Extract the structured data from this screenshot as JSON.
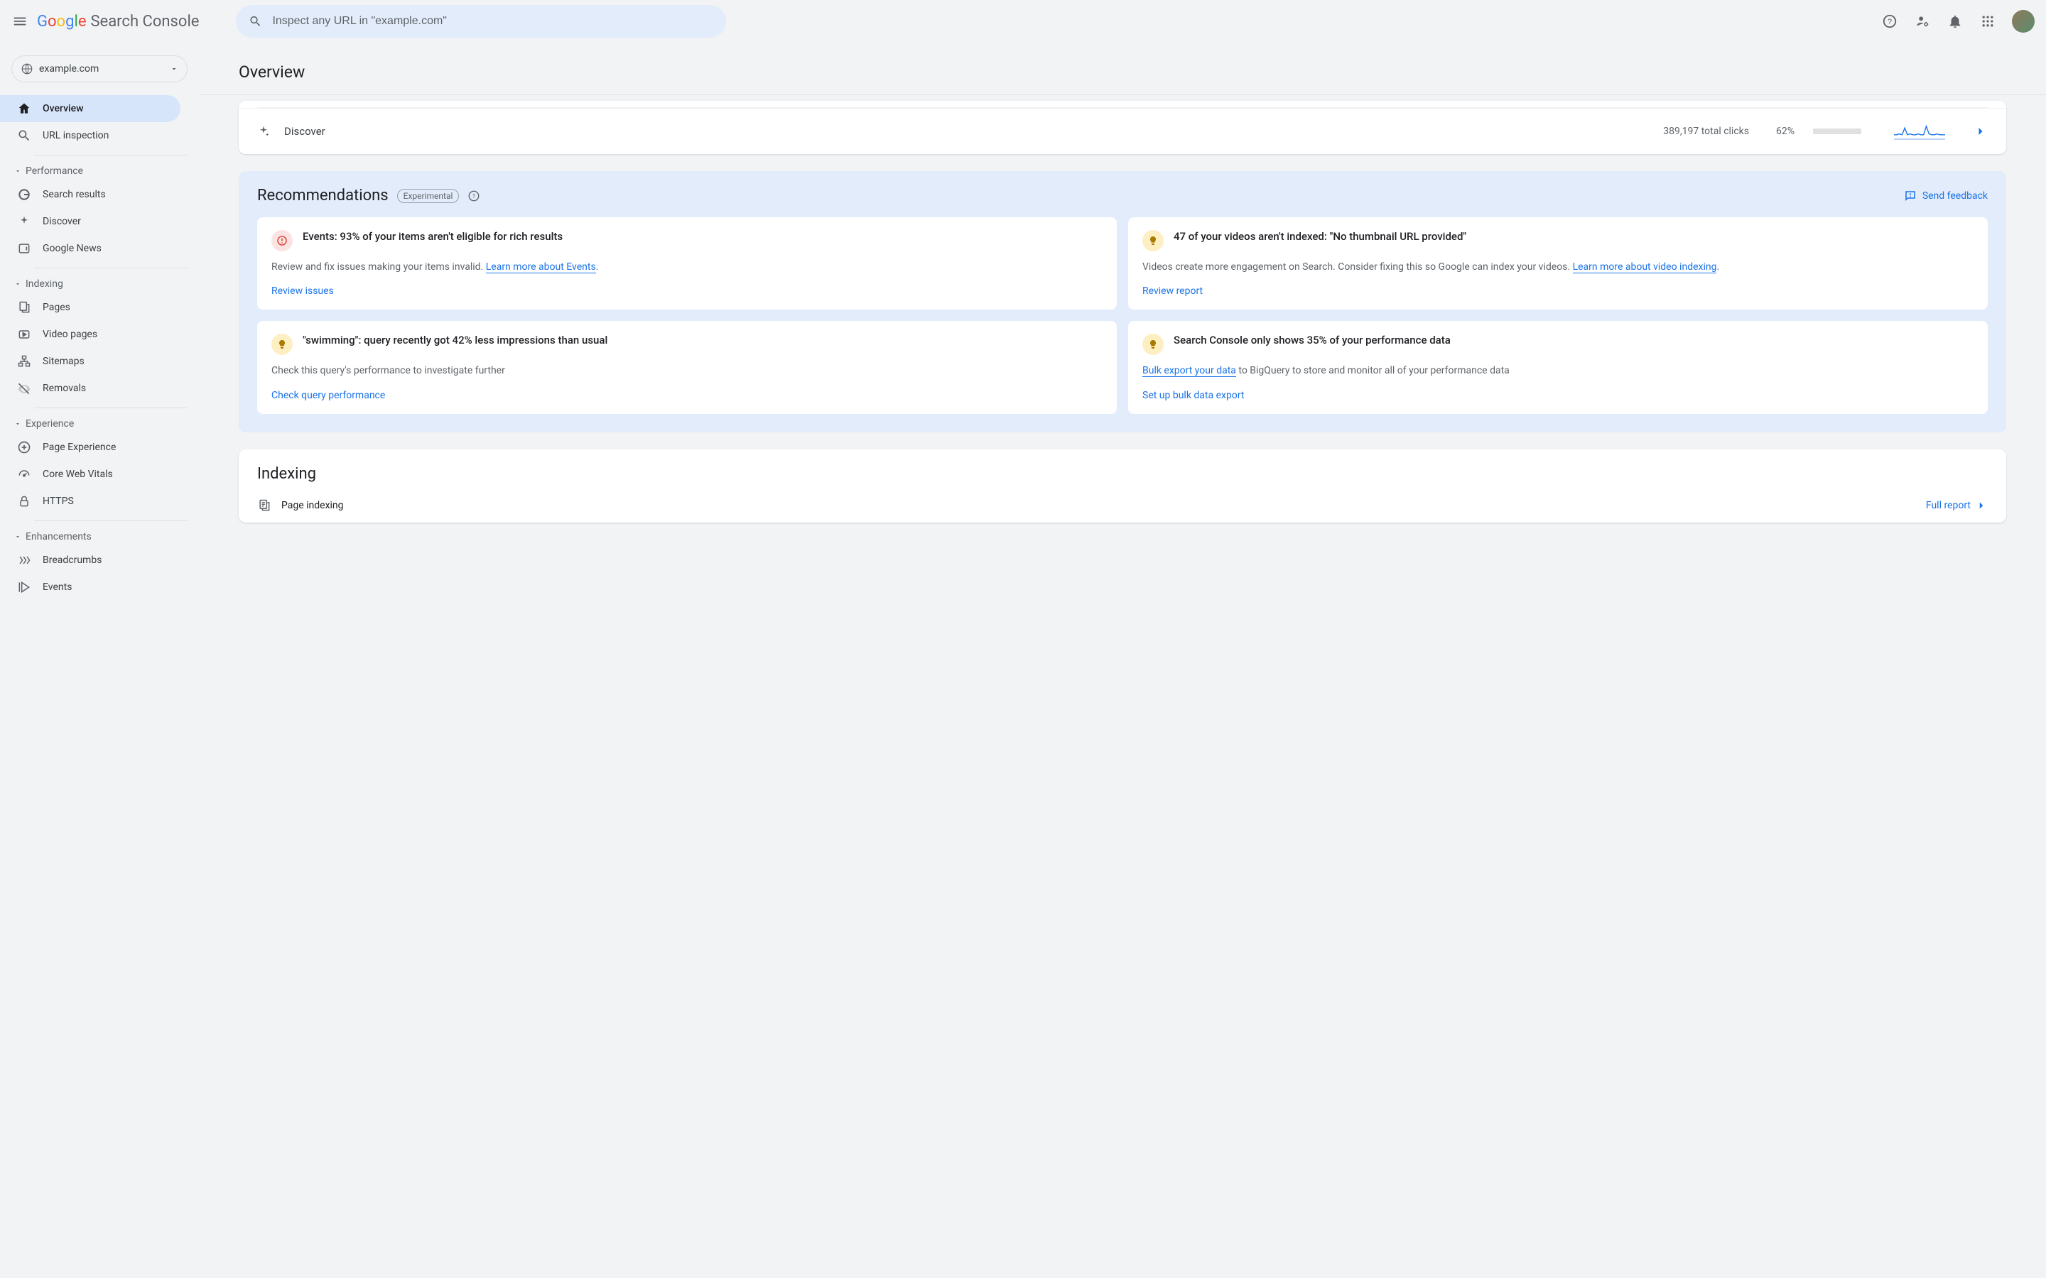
{
  "brand": {
    "name": "Google",
    "product": "Search Console"
  },
  "search": {
    "placeholder": "Inspect any URL in \"example.com\""
  },
  "property": {
    "name": "example.com"
  },
  "page_title": "Overview",
  "sidebar": {
    "top": [
      {
        "label": "Overview",
        "icon": "home",
        "active": true
      },
      {
        "label": "URL inspection",
        "icon": "search",
        "active": false
      }
    ],
    "groups": [
      {
        "label": "Performance",
        "items": [
          {
            "label": "Search results",
            "icon": "google-g"
          },
          {
            "label": "Discover",
            "icon": "sparkle"
          },
          {
            "label": "Google News",
            "icon": "news"
          }
        ]
      },
      {
        "label": "Indexing",
        "items": [
          {
            "label": "Pages",
            "icon": "pages"
          },
          {
            "label": "Video pages",
            "icon": "video"
          },
          {
            "label": "Sitemaps",
            "icon": "sitemap"
          },
          {
            "label": "Removals",
            "icon": "visibility-off"
          }
        ]
      },
      {
        "label": "Experience",
        "items": [
          {
            "label": "Page Experience",
            "icon": "plus-circle"
          },
          {
            "label": "Core Web Vitals",
            "icon": "speed"
          },
          {
            "label": "HTTPS",
            "icon": "lock"
          }
        ]
      },
      {
        "label": "Enhancements",
        "items": [
          {
            "label": "Breadcrumbs",
            "icon": "breadcrumb"
          },
          {
            "label": "Events",
            "icon": "events"
          }
        ]
      }
    ]
  },
  "discover": {
    "label": "Discover",
    "clicks_text": "389,197 total clicks",
    "pct_text": "62%",
    "pct_value": 62
  },
  "recommendations": {
    "title": "Recommendations",
    "badge": "Experimental",
    "feedback": "Send feedback",
    "cards": [
      {
        "severity": "error",
        "title": "Events: 93% of your items aren't eligible for rich results",
        "body_pre": "Review and fix issues making your items invalid. ",
        "link": "Learn more about Events",
        "body_post": ".",
        "action": "Review issues"
      },
      {
        "severity": "tip",
        "title": "47 of your videos aren't indexed: \"No thumbnail URL provided\"",
        "body_pre": "Videos create more engagement on Search. Consider fixing this so Google can index your videos. ",
        "link": "Learn more about video indexing",
        "body_post": ".",
        "action": "Review report"
      },
      {
        "severity": "tip",
        "title": "\"swimming\": query recently got 42% less impressions than usual",
        "body_pre": "Check this query's performance to investigate further",
        "link": "",
        "body_post": "",
        "action": "Check query performance"
      },
      {
        "severity": "tip",
        "title": "Search Console only shows 35% of your performance data",
        "body_pre": "",
        "link": "Bulk export your data",
        "body_post": " to BigQuery to store and monitor all of your performance data",
        "action": "Set up bulk data export"
      }
    ]
  },
  "indexing_section": {
    "title": "Indexing",
    "row_label": "Page indexing",
    "full_report": "Full report"
  },
  "chart_data": {
    "type": "line",
    "title": "Discover clicks sparkline",
    "x": [
      0,
      1,
      2,
      3,
      4,
      5,
      6,
      7,
      8,
      9,
      10,
      11,
      12,
      13,
      14,
      15,
      16,
      17,
      18,
      19
    ],
    "values": [
      6,
      6,
      7,
      6,
      14,
      6,
      7,
      6,
      6,
      7,
      6,
      6,
      16,
      7,
      6,
      6,
      7,
      6,
      6,
      6
    ],
    "ylim": [
      0,
      20
    ],
    "color": "#1a73e8"
  }
}
